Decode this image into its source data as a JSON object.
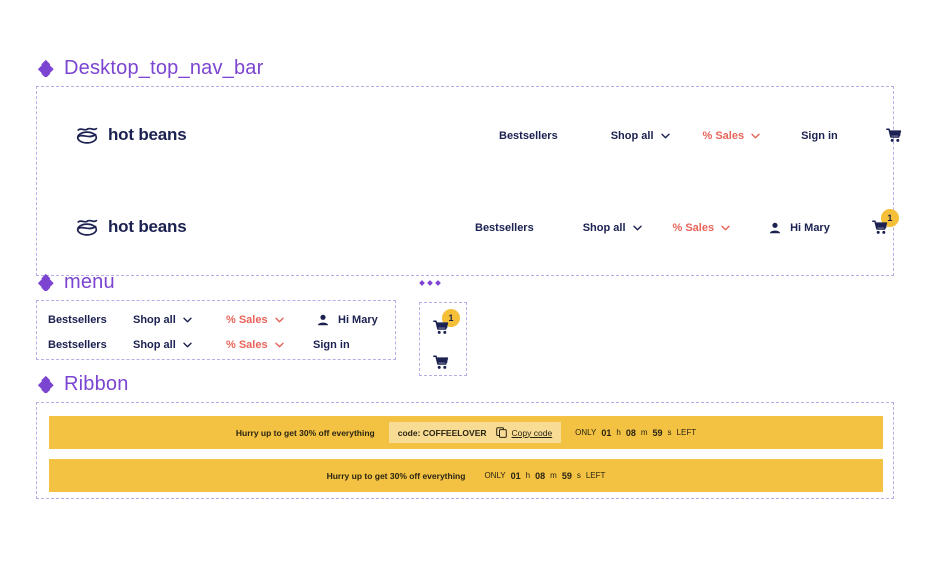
{
  "sections": {
    "desktop_nav": {
      "label": "Desktop_top_nav_bar",
      "icon": "diamond-cluster-icon"
    },
    "menu": {
      "label": "menu",
      "icon": "diamond-cluster-icon"
    },
    "cart_component": {
      "label": "...",
      "icon": "diamond-dots-icon"
    },
    "ribbon": {
      "label": "Ribbon",
      "icon": "diamond-cluster-icon"
    }
  },
  "brand": {
    "name": "hot beans",
    "logo_icon": "coffee-bean-wave-logo-icon"
  },
  "nav_guest": {
    "bestsellers": "Bestsellers",
    "shop_all": "Shop all",
    "sales": "% Sales",
    "sign_in": "Sign in",
    "cart_icon": "shopping-cart-icon",
    "chevron_icon": "chevron-down-icon"
  },
  "nav_user": {
    "bestsellers": "Bestsellers",
    "shop_all": "Shop all",
    "sales": "% Sales",
    "greeting": "Hi Mary",
    "user_icon": "person-icon",
    "cart_icon": "shopping-cart-icon",
    "cart_count": "1",
    "chevron_icon": "chevron-down-icon"
  },
  "menu_rows": [
    {
      "bestsellers": "Bestsellers",
      "shop_all": "Shop all",
      "sales": "% Sales",
      "account": "Hi Mary",
      "account_icon": "person-icon"
    },
    {
      "bestsellers": "Bestsellers",
      "shop_all": "Shop all",
      "sales": "% Sales",
      "account": "Sign in",
      "account_icon": "none"
    }
  ],
  "cart_states": [
    {
      "icon": "shopping-cart-icon",
      "count": "1"
    },
    {
      "icon": "shopping-cart-icon",
      "count": ""
    }
  ],
  "ribbons": [
    {
      "message": "Hurry up to get 30% off everything",
      "code_label": "code: COFFEELOVER",
      "copy_label": "Copy code",
      "copy_icon": "copy-icon",
      "only": "ONLY",
      "hours": "01",
      "hours_unit": "h",
      "minutes": "08",
      "minutes_unit": "m",
      "seconds": "59",
      "seconds_unit": "s",
      "left": "LEFT",
      "has_code": true
    },
    {
      "message": "Hurry up to get 30% off everything",
      "only": "ONLY",
      "hours": "01",
      "hours_unit": "h",
      "minutes": "08",
      "minutes_unit": "m",
      "seconds": "59",
      "seconds_unit": "s",
      "left": "LEFT",
      "has_code": false
    }
  ],
  "colors": {
    "frame_label": "#7b44d1",
    "frame_border": "#b7aee8",
    "navy": "#1b2150",
    "sales_red": "#e8645a",
    "ribbon_gold": "#f3c242",
    "code_pill": "#f8dc94",
    "badge_yellow": "#f5c038"
  }
}
